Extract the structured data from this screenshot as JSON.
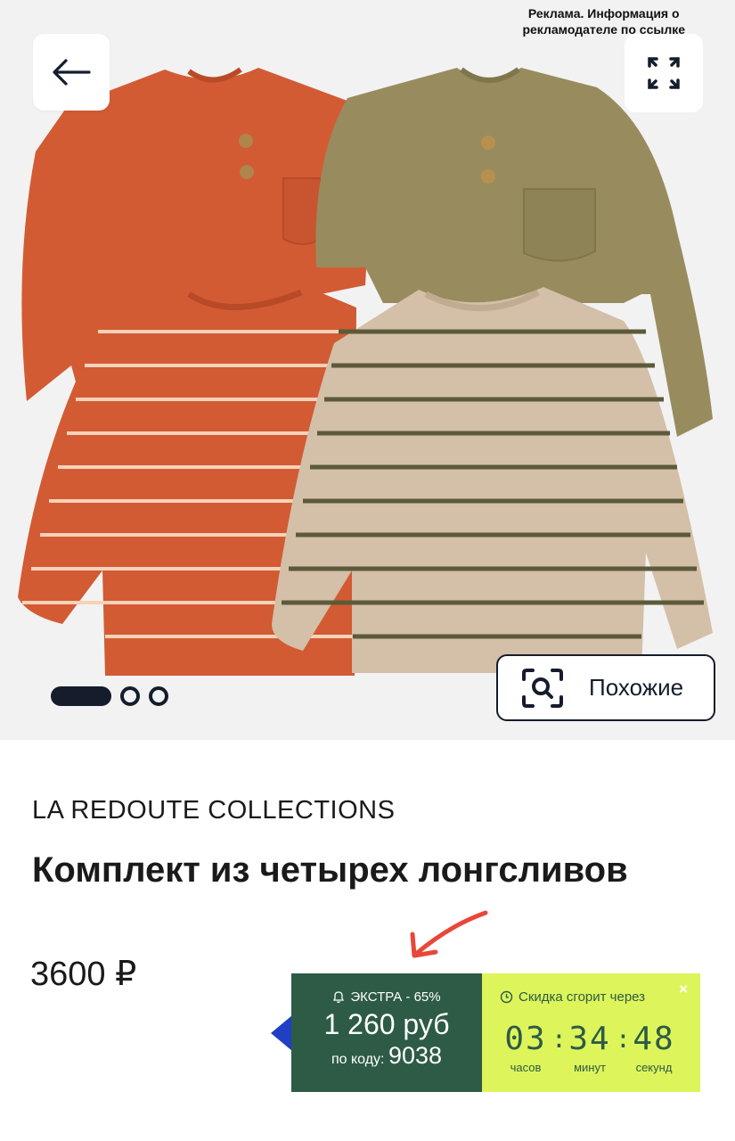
{
  "ad": {
    "line1": "Реклама. Информация о",
    "line2": "рекламодателе по ссылке"
  },
  "gallery": {
    "back_icon": "arrow-left-icon",
    "expand_icon": "fullscreen-expand-icon",
    "images_count": 3,
    "active_index": 0,
    "similar_label": "Похожие",
    "similar_icon": "visual-search-icon",
    "shirt_colors": [
      "#d25b33",
      "#988c5e",
      "#d4bfa8"
    ]
  },
  "product": {
    "brand": "LA REDOUTE COLLECTIONS",
    "title": "Комплект из четырех лонгсливов",
    "price": "3600 ₽"
  },
  "promo": {
    "extra_label": "ЭКСТРА - 65%",
    "extra_icon": "bell-icon",
    "discount_price": "1 260 руб",
    "code_label": "по коду:",
    "code_value": "9038",
    "timer_label": "Скидка сгорит через",
    "timer_icon": "clock-icon",
    "hours": "03",
    "minutes": "34",
    "seconds": "48",
    "hours_label": "часов",
    "minutes_label": "минут",
    "seconds_label": "секунд",
    "close_label": "×",
    "colors": {
      "dark": "#2d5b46",
      "lime": "#ddf55a",
      "notch": "#1f3fc5"
    }
  },
  "annotation_arrow_color": "#e8473a"
}
